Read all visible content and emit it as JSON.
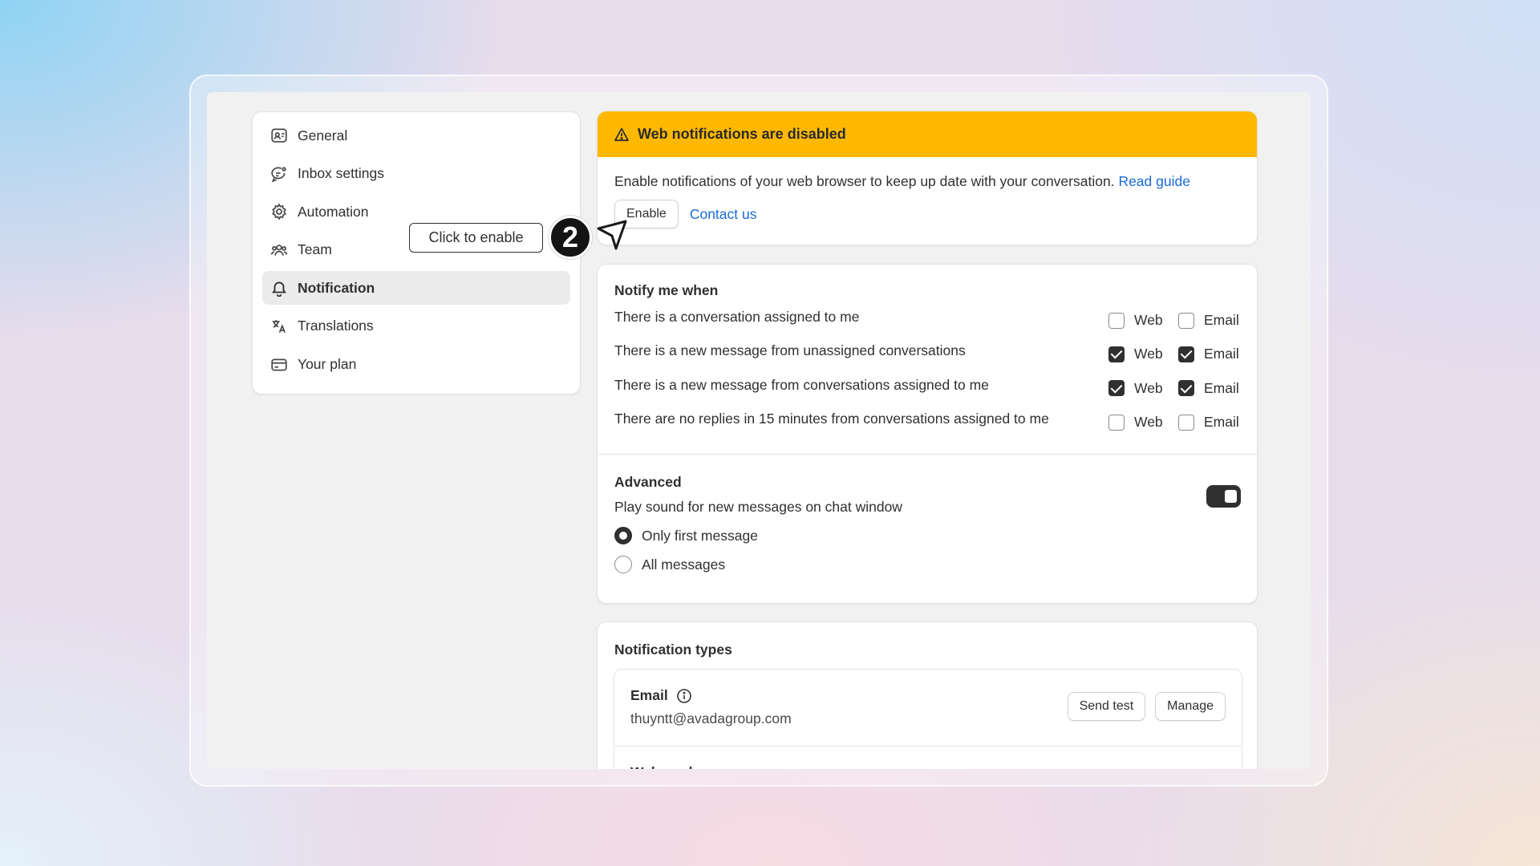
{
  "sidebar": {
    "items": [
      {
        "label": "General",
        "icon": "profile-card-icon"
      },
      {
        "label": "Inbox settings",
        "icon": "chat-gear-icon"
      },
      {
        "label": "Automation",
        "icon": "gear-icon"
      },
      {
        "label": "Team",
        "icon": "people-icon"
      },
      {
        "label": "Notification",
        "icon": "bell-icon",
        "active": true
      },
      {
        "label": "Translations",
        "icon": "translate-icon"
      },
      {
        "label": "Your plan",
        "icon": "credit-card-icon"
      }
    ]
  },
  "banner": {
    "title": "Web notifications are disabled",
    "text": "Enable notifications of your web browser to keep up date with your conversation.",
    "read_guide": "Read guide",
    "enable_label": "Enable",
    "contact_label": "Contact us"
  },
  "notify": {
    "title": "Notify me when",
    "web_label": "Web",
    "email_label": "Email",
    "rows": [
      {
        "label": "There is a conversation assigned to me",
        "web": false,
        "email": false
      },
      {
        "label": "There is a new message from unassigned conversations",
        "web": true,
        "email": true
      },
      {
        "label": "There is a new message from conversations assigned to me",
        "web": true,
        "email": true
      },
      {
        "label": "There are no replies in 15 minutes from conversations assigned to me",
        "web": false,
        "email": false
      }
    ]
  },
  "advanced": {
    "title": "Advanced",
    "subtitle": "Play sound for new messages on chat window",
    "toggle_on": true,
    "options": [
      {
        "label": "Only first message",
        "selected": true
      },
      {
        "label": "All messages",
        "selected": false
      }
    ]
  },
  "types": {
    "title": "Notification types",
    "email_title": "Email",
    "email_address": "thuyntt@avadagroup.com",
    "send_test_label": "Send test",
    "manage_label": "Manage",
    "next_row_title": "Web push"
  },
  "overlay": {
    "tooltip": "Click to enable",
    "step_number": "2"
  }
}
